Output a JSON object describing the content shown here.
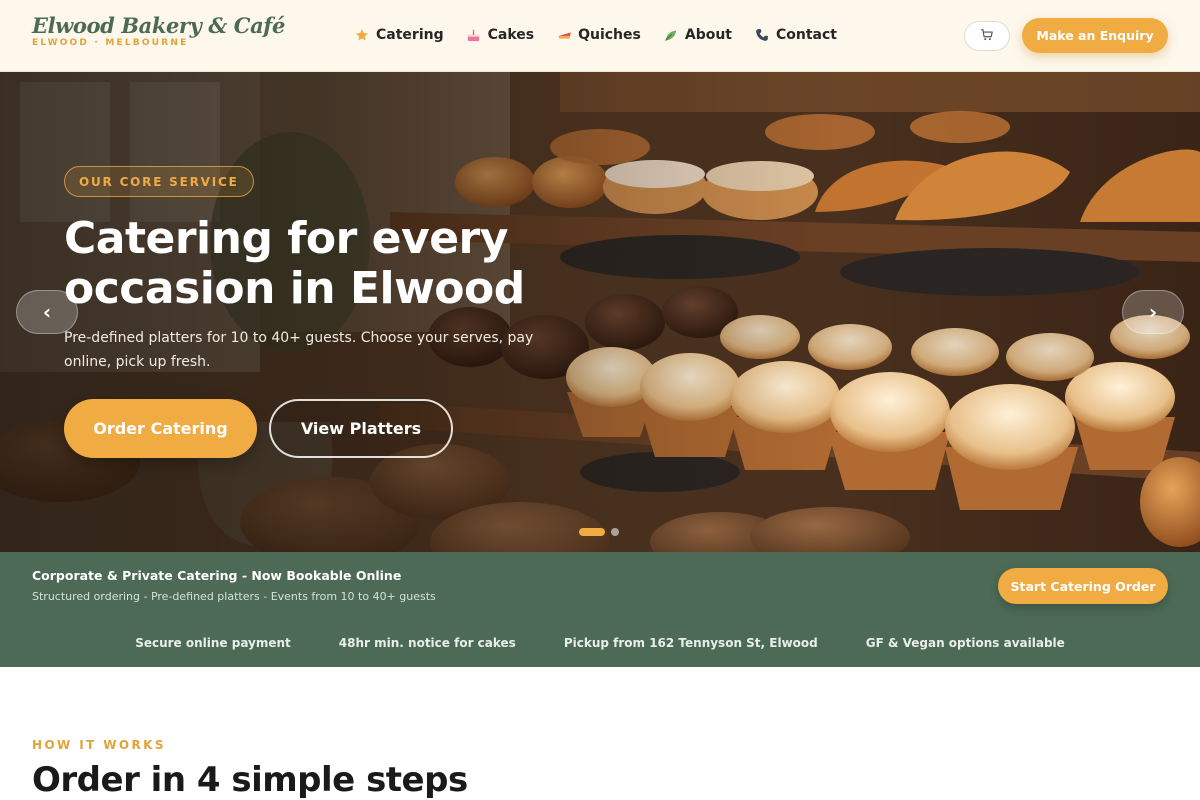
{
  "brand": {
    "name": "Elwood Bakery & Café",
    "tagline": "ELWOOD · MELBOURNE"
  },
  "nav": {
    "items": [
      {
        "label": "Catering",
        "icon": "star-icon"
      },
      {
        "label": "Cakes",
        "icon": "cake-icon"
      },
      {
        "label": "Quiches",
        "icon": "pie-icon"
      },
      {
        "label": "About",
        "icon": "leaf-icon"
      },
      {
        "label": "Contact",
        "icon": "phone-icon"
      }
    ],
    "cart_icon": "cart-icon",
    "enquiry_label": "Make an Enquiry"
  },
  "hero": {
    "badge": "OUR CORE SERVICE",
    "title": "Catering for every occasion in Elwood",
    "subtitle": "Pre-defined platters for 10 to 40+ guests. Choose your serves, pay online, pick up fresh.",
    "primary_cta": "Order Catering",
    "secondary_cta": "View Platters",
    "prev_arrow": "‹",
    "next_arrow": "›",
    "slides_count": 2,
    "active_slide": 1
  },
  "banner": {
    "title": "Corporate & Private Catering - Now Bookable Online",
    "subtitle": "Structured ordering - Pre-defined platters - Events from 10 to 40+ guests",
    "cta": "Start Catering Order",
    "features": [
      "Secure online payment",
      "48hr min. notice for cakes",
      "Pickup from 162 Tennyson St, Elwood",
      "GF & Vegan options available"
    ]
  },
  "how_it_works": {
    "label": "HOW IT WORKS",
    "title": "Order in 4 simple steps"
  },
  "colors": {
    "accent": "#f0ab43",
    "brand_green": "#4c6a55",
    "header_bg": "#fdf7ec"
  }
}
